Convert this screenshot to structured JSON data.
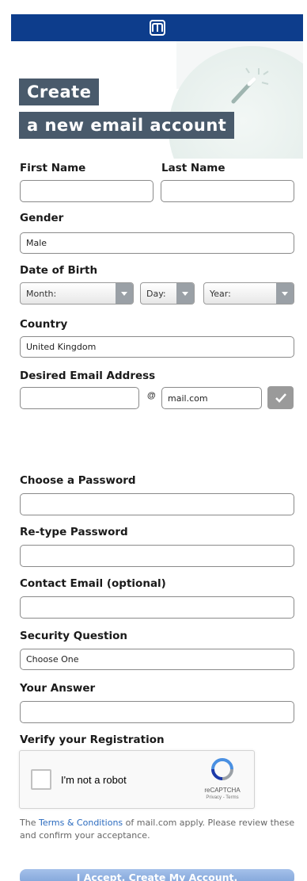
{
  "header": {
    "logo_icon": "mail-com-logo-icon",
    "brand_color": "#0d3d8c"
  },
  "hero": {
    "title_line1": "Create",
    "title_line2": "a new email account",
    "title_bg": "#495a6b"
  },
  "form": {
    "first_name": {
      "label": "First Name",
      "value": ""
    },
    "last_name": {
      "label": "Last Name",
      "value": ""
    },
    "gender": {
      "label": "Gender",
      "value": "Male"
    },
    "dob": {
      "label": "Date of Birth",
      "month": "Month:",
      "day": "Day:",
      "year": "Year:"
    },
    "country": {
      "label": "Country",
      "value": "United Kingdom"
    },
    "email": {
      "label": "Desired Email Address",
      "value": "",
      "at": "@",
      "domain": "mail.com",
      "check_icon": "checkmark-icon"
    },
    "password": {
      "label": "Choose a Password",
      "value": ""
    },
    "retype_password": {
      "label": "Re-type Password",
      "value": ""
    },
    "contact_email": {
      "label": "Contact Email (optional)",
      "value": ""
    },
    "security_question": {
      "label": "Security Question",
      "value": "Choose One"
    },
    "answer": {
      "label": "Your Answer",
      "value": ""
    }
  },
  "verify": {
    "label": "Verify your Registration",
    "captcha_text": "I'm not a robot",
    "captcha_brand": "reCAPTCHA",
    "captcha_links": "Privacy - Terms"
  },
  "terms": {
    "prefix": "The ",
    "link": "Terms & Conditions",
    "suffix": " of mail.com apply. Please review these and confirm your acceptance."
  },
  "submit_label": "I Accept. Create My Account."
}
